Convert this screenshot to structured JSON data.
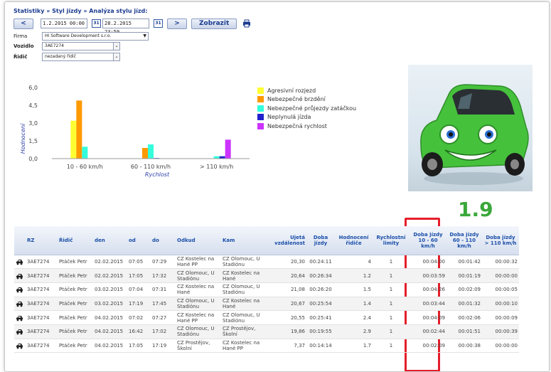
{
  "breadcrumb": "Statistiky » Styl jízdy » Analýza stylu jízd:",
  "controls": {
    "prev_label": "<",
    "next_label": ">",
    "date_from": "1.2.2015 00:00",
    "date_to": "28.2.2015 23:59",
    "calendar_glyph": "31",
    "show_label": "Zobrazit"
  },
  "filters": {
    "company_label": "Firma",
    "company_value": "HI Software Development s.r.o.",
    "vehicle_label": "Vozidlo",
    "vehicle_value": "3AE7274",
    "driver_label": "Řidič",
    "driver_value": "nezadaný řidič"
  },
  "chart_data": {
    "type": "bar",
    "ylabel": "Hodnocení",
    "xlabel": "Rychlost",
    "ylim": [
      0,
      6
    ],
    "yticks": [
      "6,0",
      "4,5",
      "3,0",
      "1,5",
      "0,0"
    ],
    "categories": [
      "10 - 60 km/h",
      "60 - 110 km/h",
      "> 110 km/h"
    ],
    "series": [
      {
        "name": "Agresivní rozjezd",
        "color": "#ffff33",
        "values": [
          3.2,
          0.0,
          0.0
        ]
      },
      {
        "name": "Nebezpečné brzdění",
        "color": "#ff9900",
        "values": [
          4.9,
          0.9,
          0.0
        ]
      },
      {
        "name": "Nebezpečné průjezdy zatáčkou",
        "color": "#33ffdd",
        "values": [
          1.0,
          1.2,
          0.2
        ]
      },
      {
        "name": "Neplynulá jízda",
        "color": "#2222cc",
        "values": [
          0.0,
          0.05,
          0.2
        ]
      },
      {
        "name": "Nebezpečná rychlost",
        "color": "#cc33ff",
        "values": [
          0.0,
          0.0,
          1.6
        ]
      }
    ],
    "legend": "right",
    "grid": false
  },
  "score": "1.9",
  "table": {
    "headers": [
      "RZ",
      "Řidič",
      "den",
      "od",
      "do",
      "Odkud",
      "Kam",
      "Ujetá vzdálenost",
      "Doba jízdy",
      "Hodnocení řidiče",
      "Rychlostní limity",
      "Doba jízdy 10 - 60 km/h",
      "Doba jízdy 60 - 110 km/h",
      "Doba jízdy > 110 km/h"
    ],
    "rows": [
      [
        "3AE7274",
        "Ptáček Petr",
        "02.02.2015",
        "07:05",
        "07:29",
        "CZ Kostelec na Hané PP",
        "CZ Olomouc, U Stadiónu",
        "20,30",
        "00:24:11",
        "4",
        "1",
        "00:04:00",
        "00:01:42",
        "00:00:32"
      ],
      [
        "3AE7274",
        "Ptáček Petr",
        "02.02.2015",
        "17:05",
        "17:32",
        "CZ Olomouc, U Stadiónu",
        "CZ Kostelec na Hané",
        "20,64",
        "00:26:34",
        "1.2",
        "1",
        "00:03:59",
        "00:01:19",
        "00:00:00"
      ],
      [
        "3AE7274",
        "Ptáček Petr",
        "03.02.2015",
        "07:04",
        "07:31",
        "CZ Kostelec na Hané",
        "CZ Olomouc, U Stadiónu",
        "21,08",
        "00:26:20",
        "1.5",
        "1",
        "00:04:26",
        "00:02:09",
        "00:00:05"
      ],
      [
        "3AE7274",
        "Ptáček Petr",
        "03.02.2015",
        "17:19",
        "17:45",
        "CZ Olomouc, U Stadiónu",
        "CZ Kostelec na Hané",
        "20,67",
        "00:25:54",
        "1.4",
        "1",
        "00:03:44",
        "00:01:32",
        "00:00:10"
      ],
      [
        "3AE7274",
        "Ptáček Petr",
        "04.02.2015",
        "07:02",
        "07:27",
        "CZ Kostelec na Hané PP",
        "CZ Olomouc, U Stadiónu",
        "20,55",
        "00:25:41",
        "2.4",
        "1",
        "00:04:09",
        "00:02:06",
        "00:00:09"
      ],
      [
        "3AE7274",
        "Ptáček Petr",
        "04.02.2015",
        "16:42",
        "17:02",
        "CZ Olomouc, U Stadiónu",
        "CZ Prostějov, Školní",
        "19,86",
        "00:19:55",
        "2.9",
        "1",
        "00:02:44",
        "00:01:51",
        "00:00:39"
      ],
      [
        "3AE7274",
        "Ptáček Petr",
        "04.02.2015",
        "17:05",
        "17:19",
        "CZ Prostějov, Školní",
        "CZ Kostelec na Hané PP",
        "7,37",
        "00:14:14",
        "1.7",
        "1",
        "00:02:09",
        "00:00:38",
        "00:00:00"
      ]
    ]
  },
  "colors": {
    "accent": "#1b4fa8",
    "score_green": "#3aa83a",
    "highlight_red": "#e41e2a"
  },
  "icons": {
    "print": "printer-icon",
    "calendar": "calendar-icon",
    "row": "car-icon",
    "mascot": "green-car-mascot"
  }
}
